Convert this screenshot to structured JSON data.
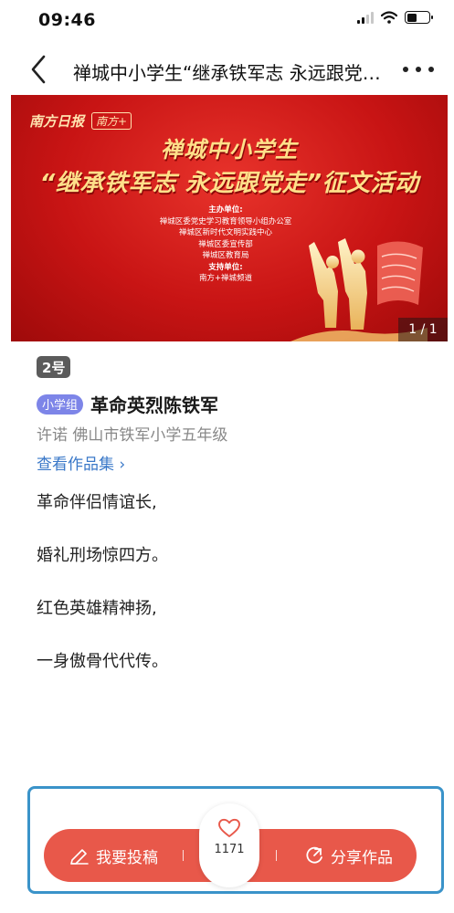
{
  "status_bar": {
    "time": "09:46"
  },
  "nav": {
    "title": "禅城中小学生“继承铁军志 永远跟党走”征文活动"
  },
  "banner": {
    "logo_text": "南方日报",
    "logo_badge": "南方+",
    "title_line1": "禅城中小学生",
    "title_line2": "“继承铁军志 永远跟党走”征文活动",
    "info_lines": [
      {
        "text": "主办单位:",
        "bold": true
      },
      {
        "text": "禅城区委党史学习教育领导小组办公室",
        "bold": false
      },
      {
        "text": "禅城区新时代文明实践中心",
        "bold": false
      },
      {
        "text": "禅城区委宣传部",
        "bold": false
      },
      {
        "text": "禅城区教育局",
        "bold": false
      },
      {
        "text": "支持单位:",
        "bold": true
      },
      {
        "text": "南方+禅城频道",
        "bold": false
      }
    ],
    "page_indicator": "1 / 1"
  },
  "entry": {
    "number": "2号",
    "group_tag": "小学组",
    "title": "革命英烈陈铁军",
    "author": "许诺 佛山市铁军小学五年级",
    "collection_link": "查看作品集 ›",
    "poem_lines": [
      "革命伴侣情谊长,",
      "婚礼刑场惊四方。",
      "红色英雄精神扬,",
      "一身傲骨代代传。"
    ]
  },
  "actions": {
    "submit_label": "我要投稿",
    "like_count": "1171",
    "share_label": "分享作品"
  },
  "colors": {
    "accent_red": "#e8584a",
    "link_blue": "#3a78c8",
    "tag_purple": "#7d85e8",
    "frame_blue": "#3a93c9"
  },
  "icons": {
    "back": "chevron-left-icon",
    "more": "more-dots-icon",
    "submit": "pen-icon",
    "like": "heart-icon",
    "share": "share-icon"
  }
}
